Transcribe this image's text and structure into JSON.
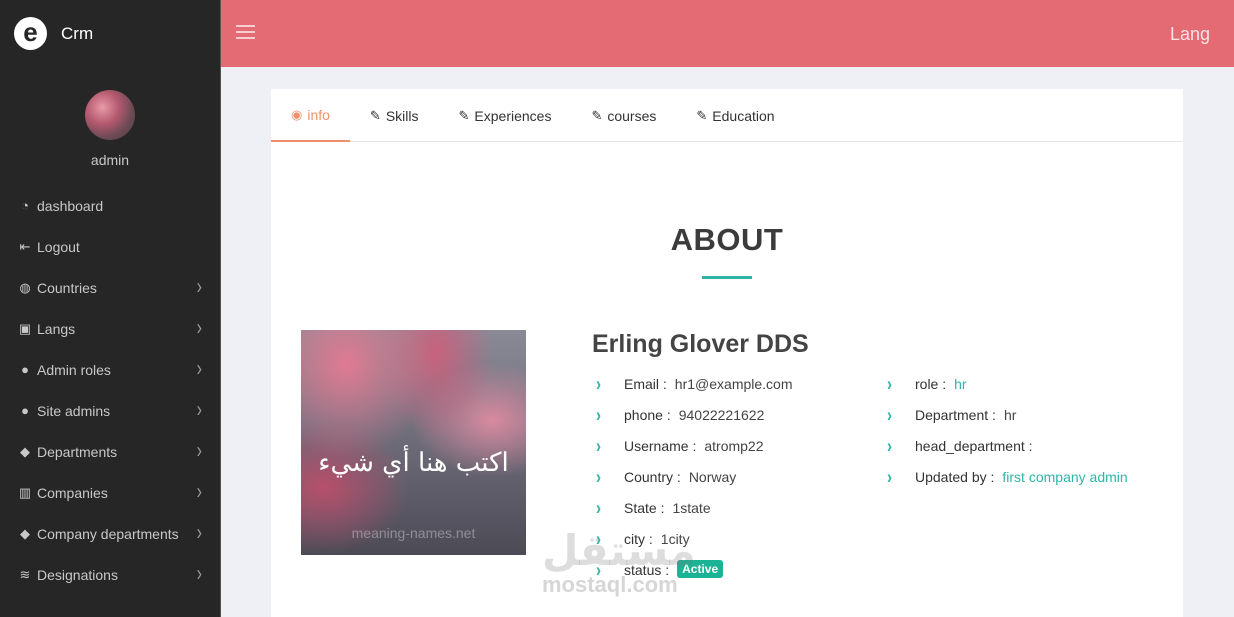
{
  "brand": {
    "logo_letter": "e",
    "name": "Crm"
  },
  "profile": {
    "name": "admin"
  },
  "sidebar": {
    "items": [
      {
        "icon": "gauge-icon",
        "glyph": "◔",
        "label": "dashboard",
        "has_children": false
      },
      {
        "icon": "logout-icon",
        "glyph": "⇤",
        "label": "Logout",
        "has_children": false
      },
      {
        "icon": "globe-icon",
        "glyph": "◍",
        "label": "Countries",
        "has_children": true
      },
      {
        "icon": "language-icon",
        "glyph": "▣",
        "label": "Langs",
        "has_children": true
      },
      {
        "icon": "user-shield-icon",
        "glyph": "●",
        "label": "Admin roles",
        "has_children": true
      },
      {
        "icon": "users-icon",
        "glyph": "●",
        "label": "Site admins",
        "has_children": true
      },
      {
        "icon": "tags-icon",
        "glyph": "◆",
        "label": "Departments",
        "has_children": true
      },
      {
        "icon": "building-icon",
        "glyph": "▥",
        "label": "Companies",
        "has_children": true
      },
      {
        "icon": "tags-icon",
        "glyph": "◆",
        "label": "Company departments",
        "has_children": true
      },
      {
        "icon": "layers-icon",
        "glyph": "≋",
        "label": "Designations",
        "has_children": true
      }
    ]
  },
  "topbar": {
    "lang": "Lang"
  },
  "tabs": [
    {
      "icon": "eye-icon",
      "glyph": "◉",
      "label": "info",
      "active": true
    },
    {
      "icon": "pencil-icon",
      "glyph": "✎",
      "label": "Skills",
      "active": false
    },
    {
      "icon": "pencil-icon",
      "glyph": "✎",
      "label": "Experiences",
      "active": false
    },
    {
      "icon": "pencil-icon",
      "glyph": "✎",
      "label": "courses",
      "active": false
    },
    {
      "icon": "pencil-icon",
      "glyph": "✎",
      "label": "Education",
      "active": false
    }
  ],
  "about": {
    "title": "ABOUT",
    "photo_caption": "اكتب هنا أي شيء",
    "photo_watermark": "meaning-names.net",
    "person_name": "Erling Glover DDS",
    "left_fields": [
      {
        "label": "Email :",
        "value": "hr1@example.com",
        "link": false
      },
      {
        "label": "phone :",
        "value": "94022221622",
        "link": false
      },
      {
        "label": "Username :",
        "value": "atromp22",
        "link": false
      },
      {
        "label": "Country :",
        "value": "Norway",
        "link": false
      },
      {
        "label": "State :",
        "value": "1state",
        "link": false
      },
      {
        "label": "city :",
        "value": "1city",
        "link": false
      }
    ],
    "status_label": "status :",
    "status_badge": "Active",
    "right_fields": [
      {
        "label": "role :",
        "value": "hr",
        "link": true
      },
      {
        "label": "Department :",
        "value": "hr",
        "link": false
      },
      {
        "label": "head_department :",
        "value": "",
        "link": false
      },
      {
        "label": "Updated by :",
        "value": "first company admin",
        "link": true
      }
    ]
  },
  "watermark": {
    "arabic": "مستقل",
    "latin": "mostaql.com"
  },
  "colors": {
    "accent_teal": "#2fb5a8",
    "tab_active": "#f0906a",
    "topbar": "#e46a73",
    "sidebar": "#262626",
    "badge": "#1ab394"
  }
}
